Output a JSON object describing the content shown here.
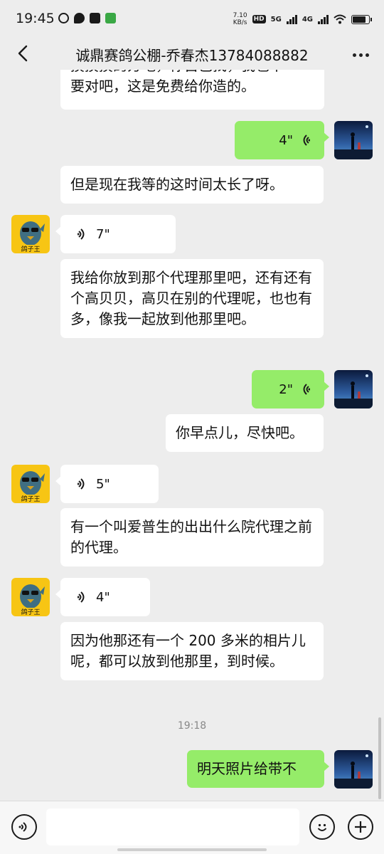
{
  "status_bar": {
    "time": "19:45",
    "net_speed_value": "7.10",
    "net_speed_unit": "KB/s",
    "hd_label": "HD",
    "sim1_tech": "5G",
    "sim2_tech": "4G",
    "battery_level": 0.85
  },
  "header": {
    "title": "诚鼎赛鸽公棚-乔春杰13784088882"
  },
  "messages": [
    {
      "id": "m1",
      "text_line1": "摸摸摸的方吧，你自己找，我也不",
      "text_line2": "要对吧，这是免费给你造的。"
    },
    {
      "id": "m2",
      "duration": "4\""
    },
    {
      "id": "m3",
      "text": "但是现在我等的这时间太长了呀。"
    },
    {
      "id": "m4",
      "duration": "7\""
    },
    {
      "id": "m5",
      "text": "我给你放到那个代理那里吧，还有还有个高贝贝，高贝在别的代理呢，也也有多，像我一起放到他那里吧。"
    },
    {
      "id": "m6",
      "duration": "2\""
    },
    {
      "id": "m7",
      "text": "你早点儿，尽快吧。"
    },
    {
      "id": "m8",
      "duration": "5\""
    },
    {
      "id": "m9",
      "text": "有一个叫爱普生的出出什么院代理之前的代理。"
    },
    {
      "id": "m10",
      "duration": "4\""
    },
    {
      "id": "m11",
      "text": "因为他那还有一个 200 多米的相片儿呢，都可以放到他那里，到时候。"
    },
    {
      "id": "m13",
      "text": "明天照片给带不"
    }
  ],
  "timestamp": "19:18",
  "contact_avatar_text": "鸽子王",
  "input": {
    "value": ""
  },
  "colors": {
    "background": "#ededed",
    "outgoing_bubble": "#95ec69",
    "incoming_bubble": "#ffffff"
  }
}
